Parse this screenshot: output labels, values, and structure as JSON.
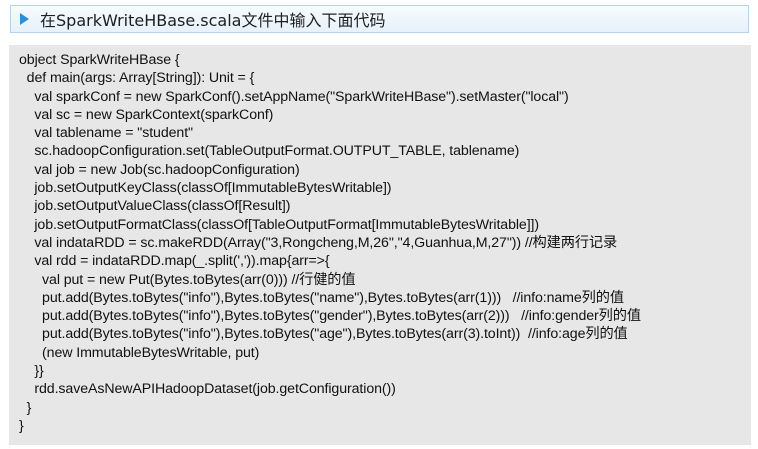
{
  "header": {
    "title": "在SparkWriteHBase.scala文件中输入下面代码"
  },
  "code": {
    "lines": [
      "object SparkWriteHBase {",
      "  def main(args: Array[String]): Unit = {",
      "    val sparkConf = new SparkConf().setAppName(\"SparkWriteHBase\").setMaster(\"local\")",
      "    val sc = new SparkContext(sparkConf)",
      "    val tablename = \"student\"",
      "    sc.hadoopConfiguration.set(TableOutputFormat.OUTPUT_TABLE, tablename)",
      "    val job = new Job(sc.hadoopConfiguration)",
      "    job.setOutputKeyClass(classOf[ImmutableBytesWritable])",
      "    job.setOutputValueClass(classOf[Result])",
      "    job.setOutputFormatClass(classOf[TableOutputFormat[ImmutableBytesWritable]])",
      "    val indataRDD = sc.makeRDD(Array(\"3,Rongcheng,M,26\",\"4,Guanhua,M,27\")) //构建两行记录",
      "    val rdd = indataRDD.map(_.split(',')).map{arr=>{",
      "      val put = new Put(Bytes.toBytes(arr(0))) //行健的值",
      "      put.add(Bytes.toBytes(\"info\"),Bytes.toBytes(\"name\"),Bytes.toBytes(arr(1)))   //info:name列的值",
      "      put.add(Bytes.toBytes(\"info\"),Bytes.toBytes(\"gender\"),Bytes.toBytes(arr(2)))   //info:gender列的值",
      "      put.add(Bytes.toBytes(\"info\"),Bytes.toBytes(\"age\"),Bytes.toBytes(arr(3).toInt))  //info:age列的值",
      "      (new ImmutableBytesWritable, put)",
      "    }}",
      "    rdd.saveAsNewAPIHadoopDataset(job.getConfiguration())",
      "  }",
      "}"
    ]
  }
}
